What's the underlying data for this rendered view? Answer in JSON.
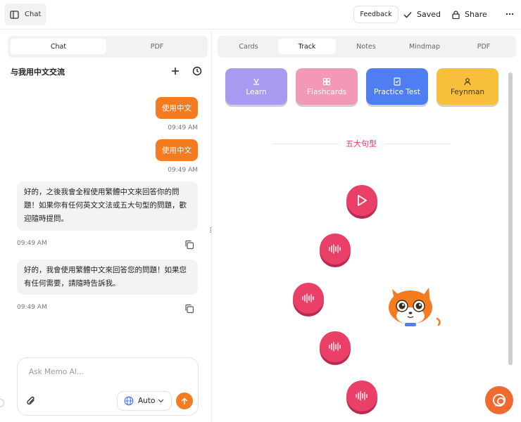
{
  "topbar": {
    "chat_toggle_label": "Chat",
    "feedback_label": "Feedback",
    "saved_label": "Saved",
    "share_label": "Share"
  },
  "left_panel": {
    "tabs": [
      {
        "label": "Chat",
        "active": true
      },
      {
        "label": "PDF",
        "active": false
      }
    ],
    "conversation_title": "与我用中文交流",
    "messages": [
      {
        "role": "user",
        "text": "使用中文",
        "time": "09:49 AM"
      },
      {
        "role": "user",
        "text": "使用中文",
        "time": "09:49 AM"
      },
      {
        "role": "assistant",
        "text": "好的，之後我會全程使用繁體中文來回答你的問題！如果你有任何英文文法或五大句型的問題，歡迎隨時提問。",
        "time": "09:49 AM"
      },
      {
        "role": "assistant",
        "text": "好的，我會使用繁體中文來回答您的問題！如果您有任何需要，請隨時告訴我。",
        "time": "09:49 AM"
      }
    ],
    "composer": {
      "placeholder": "Ask Memo AI...",
      "language": "Auto"
    }
  },
  "right_panel": {
    "tabs": [
      {
        "label": "Cards",
        "active": false
      },
      {
        "label": "Track",
        "active": true
      },
      {
        "label": "Notes",
        "active": false
      },
      {
        "label": "Mindmap",
        "active": false
      },
      {
        "label": "PDF",
        "active": false
      }
    ],
    "modes": [
      {
        "label": "Learn",
        "color": "#a99af1",
        "icon": "learn-icon"
      },
      {
        "label": "Flashcards",
        "color": "#f398b6",
        "icon": "flashcards-icon"
      },
      {
        "label": "Practice Test",
        "color": "#4f7df2",
        "icon": "practice-test-icon"
      },
      {
        "label": "Feynman",
        "color": "#f8bf3c",
        "icon": "feynman-icon"
      }
    ],
    "track_section_title": "五大句型",
    "track_nodes": [
      {
        "icon": "play-icon"
      },
      {
        "icon": "audio-wave-icon"
      },
      {
        "icon": "audio-wave-icon"
      },
      {
        "icon": "audio-wave-icon"
      },
      {
        "icon": "audio-wave-icon"
      }
    ]
  },
  "colors": {
    "accent_orange": "#f47b20",
    "track_pink": "#ea4068"
  }
}
